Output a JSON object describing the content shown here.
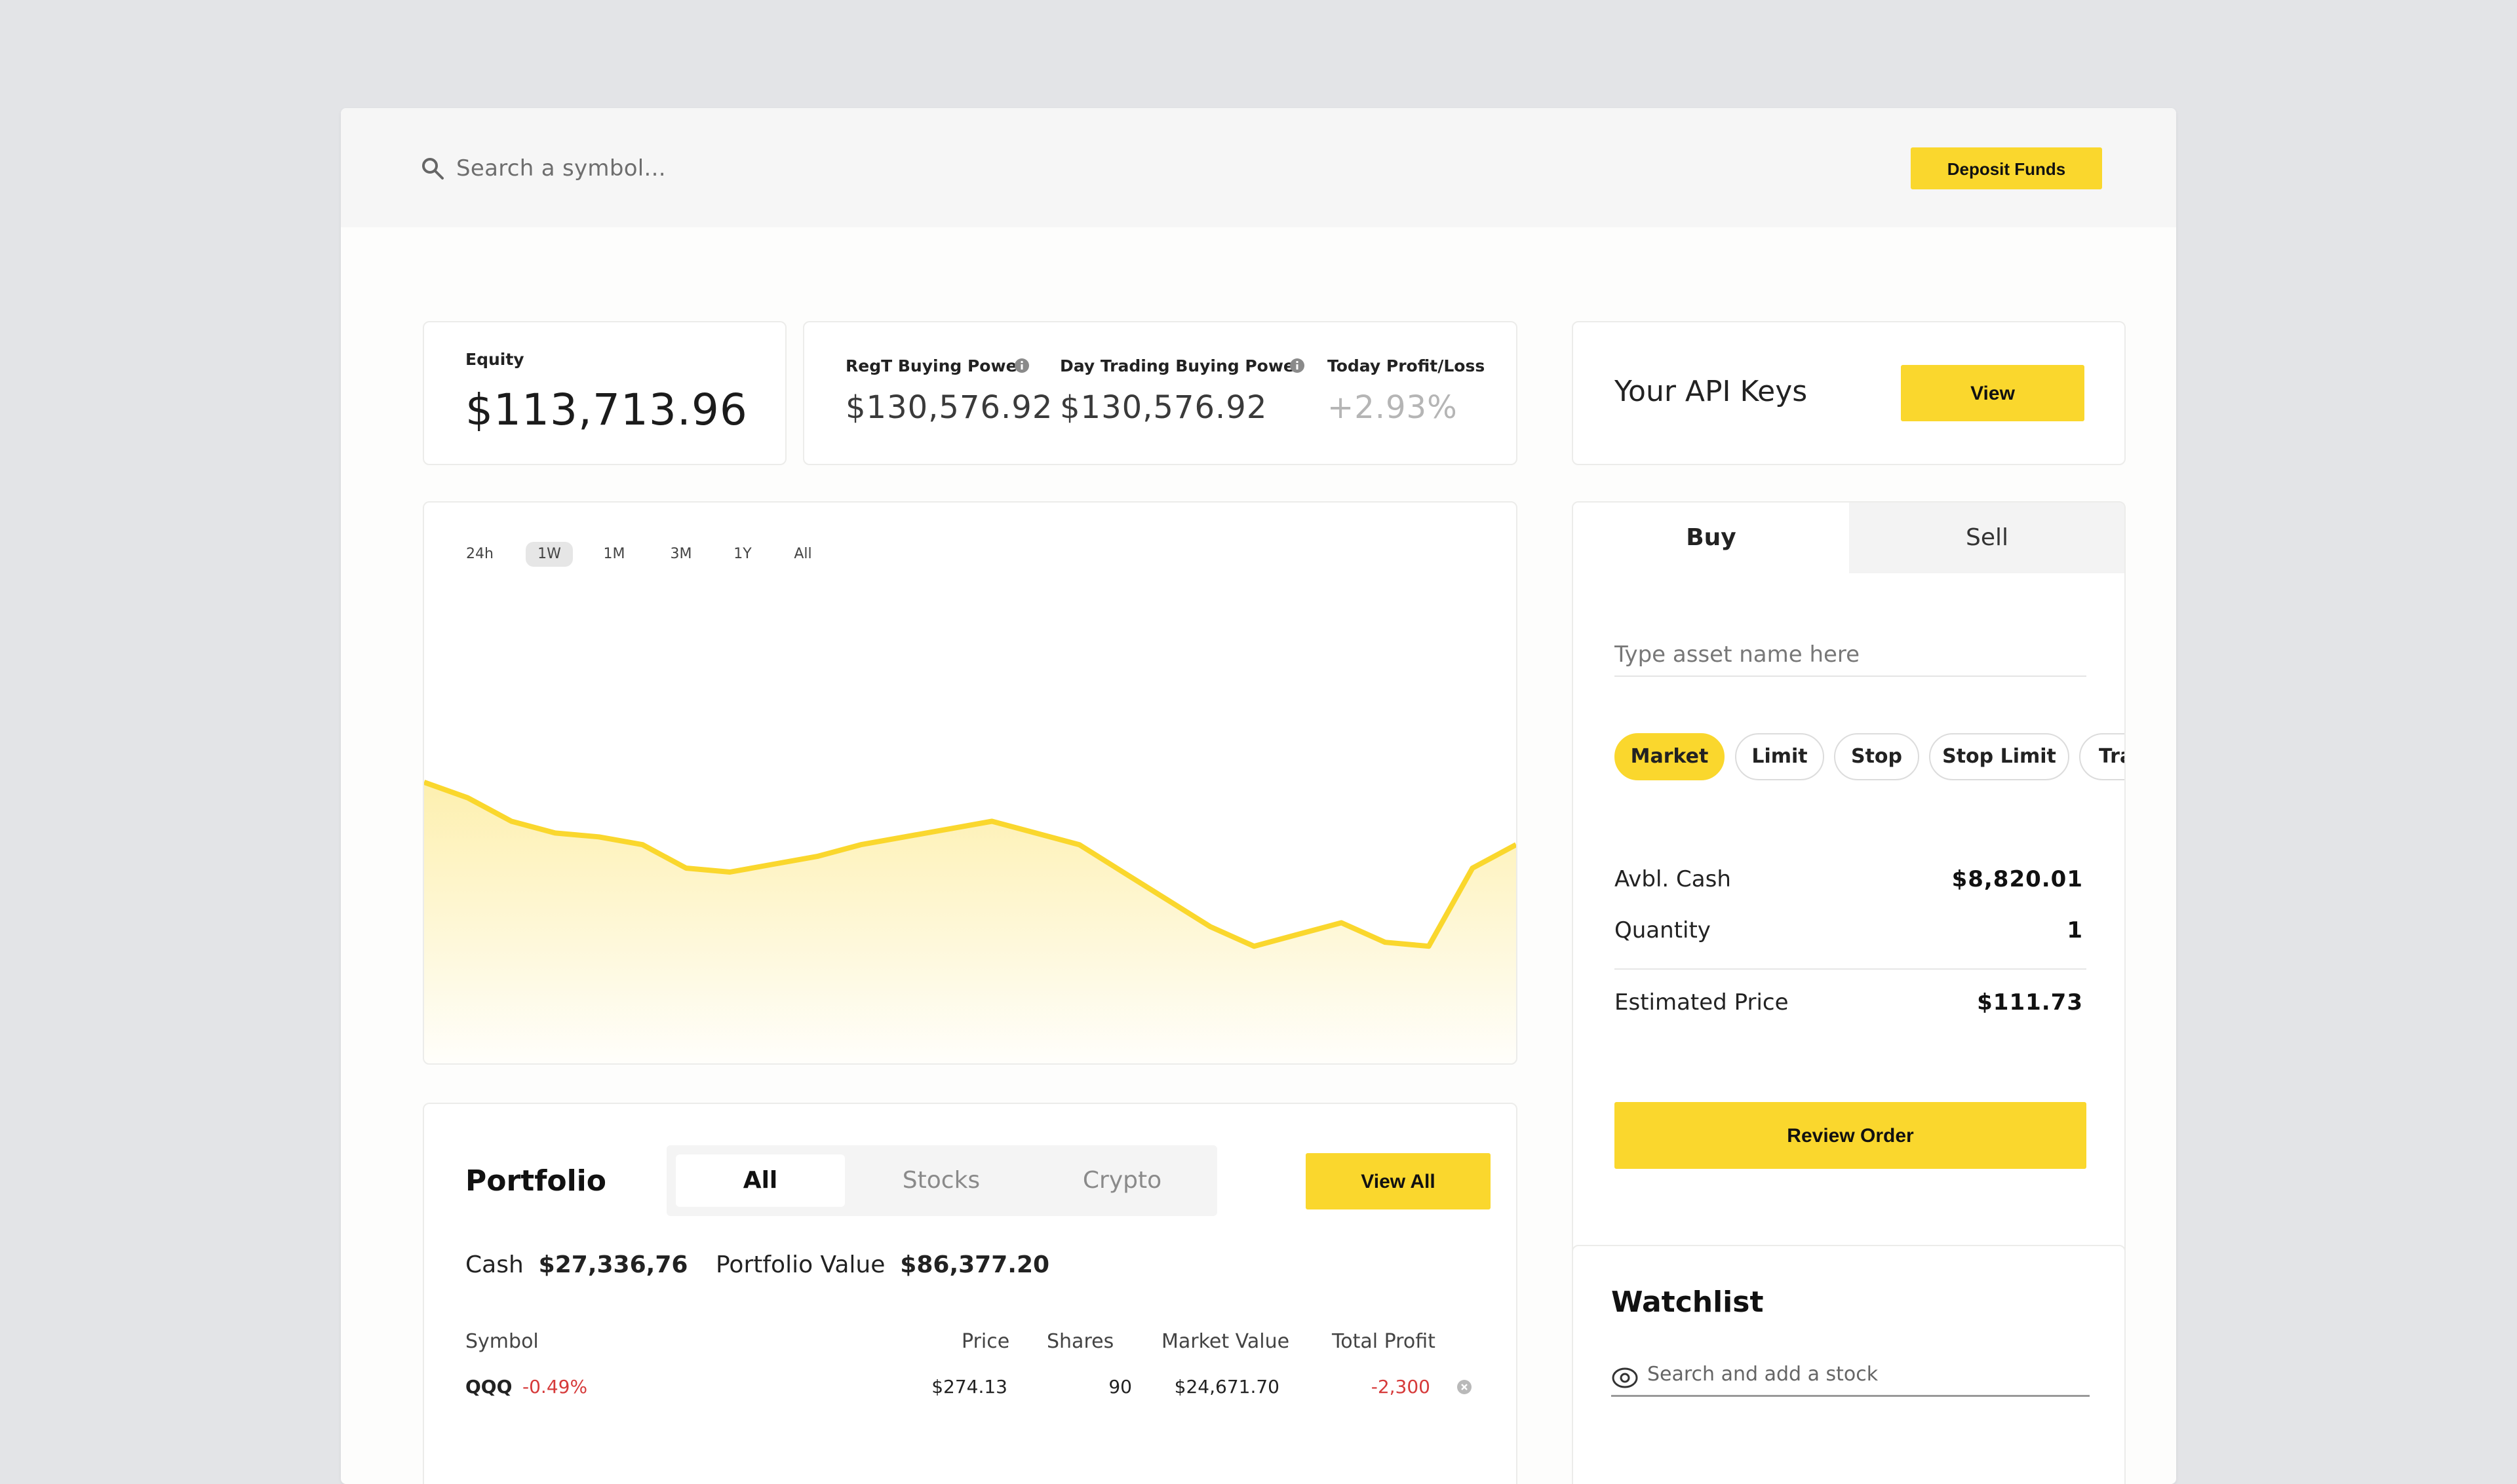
{
  "topbar": {
    "search_placeholder": "Search a symbol...",
    "deposit_label": "Deposit Funds"
  },
  "stats": {
    "equity_label": "Equity",
    "equity_value": "$113,713.96",
    "regt_label": "RegT Buying Power",
    "regt_value": "$130,576.92",
    "daytrade_label": "Day Trading Buying Power",
    "daytrade_value": "$130,576.92",
    "profit_label": "Today Profit/Loss",
    "profit_value": "+2.93%"
  },
  "chart": {
    "ranges": [
      "24h",
      "1W",
      "1M",
      "3M",
      "1Y",
      "All"
    ],
    "active_range": "1W"
  },
  "chart_data": {
    "type": "area",
    "title": "",
    "xlabel": "",
    "ylabel": "",
    "x": [
      0,
      1,
      2,
      3,
      4,
      5,
      6,
      7,
      8,
      9,
      10,
      11,
      12,
      13,
      14,
      15,
      16,
      17,
      18,
      19,
      20,
      21,
      22,
      23,
      24,
      25
    ],
    "values": [
      0.72,
      0.68,
      0.62,
      0.59,
      0.58,
      0.56,
      0.5,
      0.49,
      0.51,
      0.53,
      0.56,
      0.58,
      0.6,
      0.62,
      0.59,
      0.56,
      0.49,
      0.42,
      0.35,
      0.3,
      0.33,
      0.36,
      0.31,
      0.3,
      0.5,
      0.56
    ],
    "grid": false,
    "color": "#fad72d"
  },
  "portfolio": {
    "title": "Portfolio",
    "tabs": [
      "All",
      "Stocks",
      "Crypto"
    ],
    "active_tab": "All",
    "view_all_label": "View All",
    "cash_label": "Cash",
    "cash_value": "$27,336,76",
    "value_label": "Portfolio Value",
    "value_value": "$86,377.20",
    "columns": [
      "Symbol",
      "Price",
      "Shares",
      "Market Value",
      "Total Profit"
    ],
    "rows": [
      {
        "symbol": "QQQ",
        "change": "-0.49%",
        "price": "$274.13",
        "shares": "90",
        "market_value": "$24,671.70",
        "total_profit": "-2,300"
      }
    ]
  },
  "api": {
    "title": "Your API Keys",
    "view_label": "View"
  },
  "order": {
    "tab_buy": "Buy",
    "tab_sell": "Sell",
    "asset_placeholder": "Type asset name here",
    "order_types": [
      "Market",
      "Limit",
      "Stop",
      "Stop Limit",
      "Trailing Stop"
    ],
    "active_type": "Market",
    "cash_label": "Avbl. Cash",
    "cash_value": "$8,820.01",
    "quantity_label": "Quantity",
    "quantity_value": "1",
    "est_label": "Estimated Price",
    "est_value": "$111.73",
    "review_label": "Review Order"
  },
  "watchlist": {
    "title": "Watchlist",
    "search_placeholder": "Search and add a stock"
  },
  "colors": {
    "accent": "#fad72d",
    "negative": "#d63a3a",
    "background": "#e3e4e7"
  }
}
